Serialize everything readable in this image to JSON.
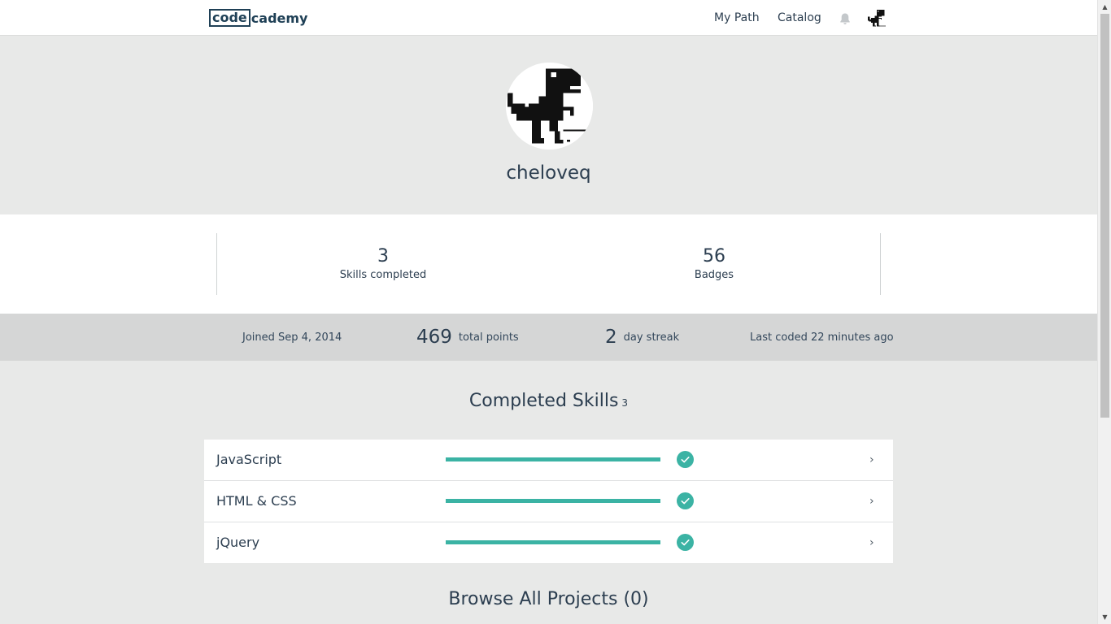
{
  "nav": {
    "logo_boxed": "code",
    "logo_rest": "cademy",
    "links": [
      "My Path",
      "Catalog"
    ],
    "icons": [
      "bell-icon",
      "user-avatar-icon"
    ]
  },
  "profile": {
    "username": "cheloveq",
    "avatar": "pixel-dinosaur"
  },
  "stats": [
    {
      "value": "3",
      "label": "Skills completed"
    },
    {
      "value": "56",
      "label": "Badges"
    }
  ],
  "band": {
    "joined": "Joined Sep 4, 2014",
    "points_value": "469",
    "points_label": "total points",
    "streak_value": "2",
    "streak_label": "day streak",
    "last_coded": "Last coded 22 minutes ago"
  },
  "completed_skills": {
    "title": "Completed Skills",
    "count": "3",
    "items": [
      {
        "name": "JavaScript",
        "progress": 1.0,
        "completed": true
      },
      {
        "name": "HTML & CSS",
        "progress": 1.0,
        "completed": true
      },
      {
        "name": "jQuery",
        "progress": 1.0,
        "completed": true
      }
    ]
  },
  "projects": {
    "title": "Browse All Projects (0)"
  },
  "colors": {
    "accent": "#3bb3a4",
    "text": "#2c3e50",
    "page_bg": "#e8e9e8",
    "band_bg": "#d5d6d6"
  }
}
